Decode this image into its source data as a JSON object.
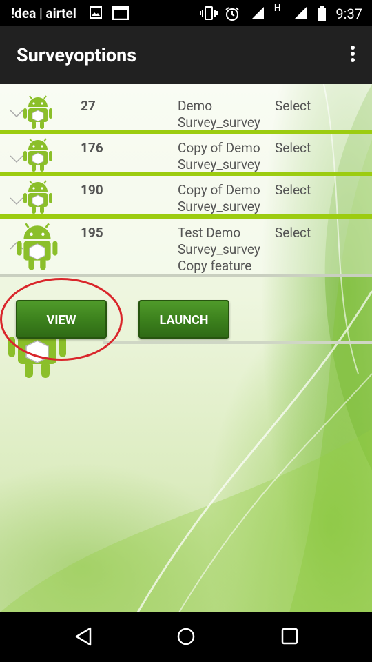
{
  "status_bar": {
    "carrier": "!dea | airtel",
    "time": "9:37",
    "network_label": "H",
    "icons": [
      "image-icon",
      "screen-icon",
      "vibrate-icon",
      "alarm-icon",
      "signal-icon",
      "signal-h-icon",
      "battery-icon"
    ]
  },
  "toolbar": {
    "title": "Surveyoptions",
    "menu_icon": "overflow-menu-icon"
  },
  "surveys": [
    {
      "id": "27",
      "name": "Demo Survey_survey",
      "action": "Select"
    },
    {
      "id": "176",
      "name": "Copy of Demo Survey_survey",
      "action": "Select"
    },
    {
      "id": "190",
      "name": "Copy of Demo Survey_survey",
      "action": "Select"
    },
    {
      "id": "195",
      "name": "Test Demo Survey_survey Copy feature",
      "action": "Select"
    }
  ],
  "actions": {
    "view_label": "VIEW",
    "launch_label": "LAUNCH"
  },
  "nav_bar": {
    "icons": [
      "back-icon",
      "home-icon",
      "recents-icon"
    ]
  },
  "colors": {
    "toolbar": "#212121",
    "button_green": "#3b7f1c",
    "divider_green": "#9ccc10",
    "highlight_red": "#d9262b"
  }
}
